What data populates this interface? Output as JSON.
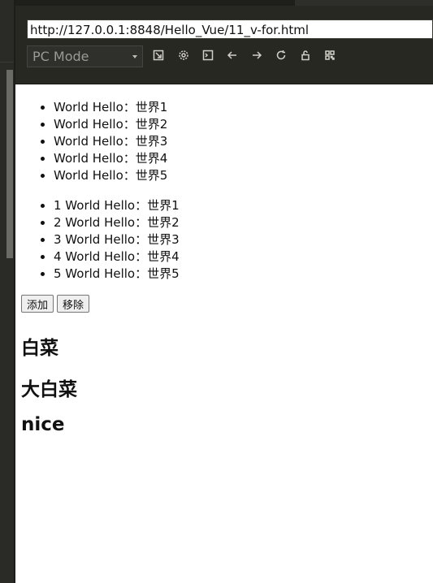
{
  "browser": {
    "url": "http://127.0.0.1:8848/Hello_Vue/11_v-for.html",
    "mode": "PC Mode",
    "toolbar_icons": [
      "open-external-icon",
      "settings-icon",
      "console-icon",
      "back-icon",
      "forward-icon",
      "refresh-icon",
      "lock-icon",
      "qr-code-icon"
    ]
  },
  "content": {
    "list1": [
      "World Hello：世界1",
      "World Hello：世界2",
      "World Hello：世界3",
      "World Hello：世界4",
      "World Hello：世界5"
    ],
    "list2": [
      "1 World Hello：世界1",
      "2 World Hello：世界2",
      "3 World Hello：世界3",
      "4 World Hello：世界4",
      "5 World Hello：世界5"
    ],
    "buttons": {
      "add": "添加",
      "remove": "移除"
    },
    "headings": [
      "白菜",
      "大白菜",
      "nice"
    ]
  }
}
